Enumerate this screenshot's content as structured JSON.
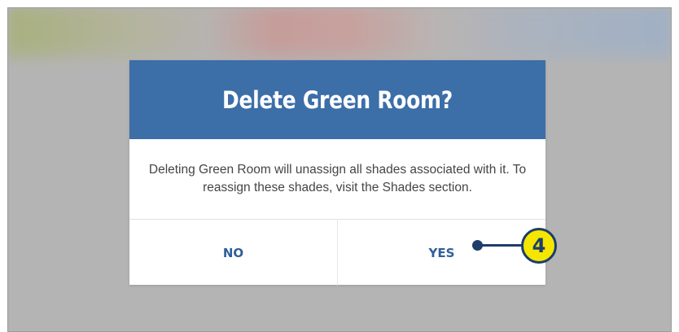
{
  "dialog": {
    "title": "Delete Green Room?",
    "message": "Deleting Green Room will unassign all shades associated with it. To reassign these shades, visit the Shades section.",
    "no_label": "NO",
    "yes_label": "YES"
  },
  "callout": {
    "number": "4"
  },
  "colors": {
    "header": "#3c6ea8",
    "button_text": "#2f5f99",
    "overlay": "#b4b4b4",
    "callout_fill": "#f4e600",
    "callout_stroke": "#1d3d6a"
  }
}
